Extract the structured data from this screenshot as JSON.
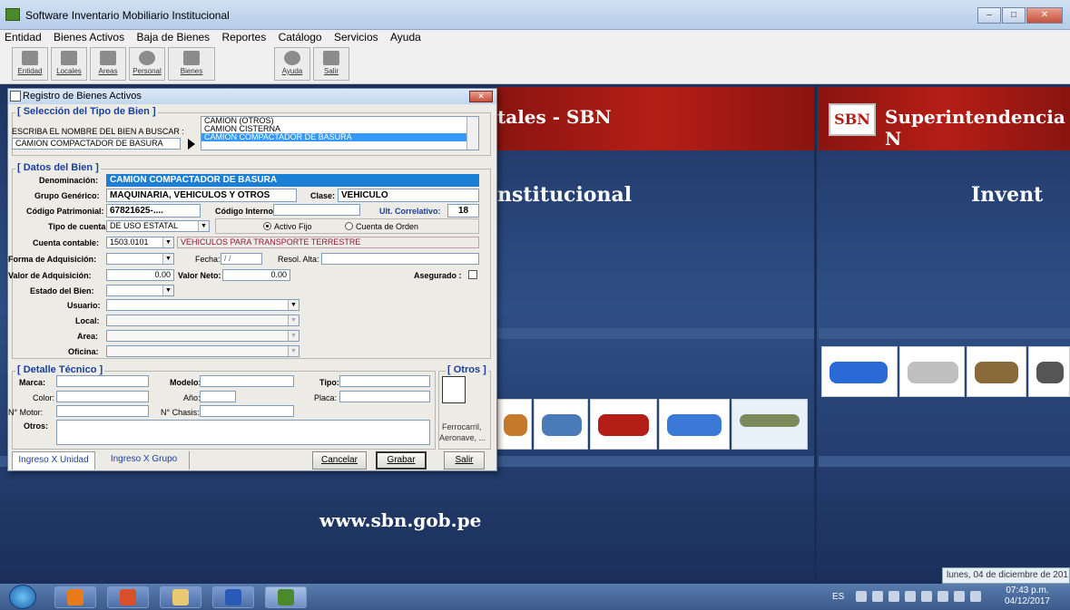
{
  "window": {
    "title": "Software Inventario Mobiliario Institucional",
    "controls": [
      "–",
      "□",
      "✕"
    ]
  },
  "menu": [
    "Entidad",
    "Bienes Activos",
    "Baja de Bienes",
    "Reportes",
    "Catálogo",
    "Servicios",
    "Ayuda"
  ],
  "toolbar": [
    "Entidad",
    "Locales",
    "Areas",
    "Personal",
    "Bienes",
    "Ayuda",
    "Salir"
  ],
  "background": {
    "band_left": "tales - SBN",
    "band_right": "Superintendencia N",
    "logo": "SBN",
    "big_left": "nstitucional",
    "big_right": "Invent",
    "url": "www.sbn.gob.pe",
    "date_chip": "lunes, 04 de diciembre de 201"
  },
  "dialog": {
    "title": "Registro de Bienes Activos",
    "close": "✕",
    "seleccion": {
      "title": "[ Selección del Tipo de Bien ]",
      "prompt": "ESCRIBA EL NOMBRE DEL BIEN A BUSCAR :",
      "search_value": "CAMION COMPACTADOR DE BASURA",
      "options": [
        "CAMION (OTROS)",
        "CAMION CISTERNA",
        "CAMION COMPACTADOR DE BASURA"
      ],
      "selected_index": 2
    },
    "datos": {
      "title": "[ Datos del Bien ]",
      "denominacion_label": "Denominación:",
      "denominacion_value": "CAMION COMPACTADOR DE BASURA",
      "grupo_label": "Grupo Genérico:",
      "grupo_value": "MAQUINARIA, VEHICULOS Y OTROS",
      "clase_label": "Clase:",
      "clase_value": "VEHICULO",
      "codigo_patrimonial_label": "Código Patrimonial:",
      "codigo_patrimonial_value": "67821625-....",
      "codigo_interno_label": "Código Interno:",
      "codigo_interno_value": "",
      "correlativo_label": "Ult. Correlativo:",
      "correlativo_value": "18",
      "tipo_cuenta_label": "Tipo de cuenta:",
      "tipo_cuenta_value": "DE USO ESTATAL",
      "activo_fijo_label": "Activo Fijo",
      "cuenta_orden_label": "Cuenta de Orden",
      "cuenta_contable_label": "Cuenta contable:",
      "cuenta_contable_value": "1503.0101",
      "cuenta_contable_desc": "VEHICULOS PARA TRANSPORTE TERRESTRE",
      "forma_label": "Forma de Adquisición:",
      "fecha_label": "Fecha:",
      "fecha_value": " / /",
      "resol_label": "Resol. Alta:",
      "valor_label": "Valor de Adquisición:",
      "valor_value": "0.00",
      "valor_neto_label": "Valor Neto:",
      "valor_neto_value": "0.00",
      "asegurado_label": "Asegurado :",
      "estado_label": "Estado del Bien:",
      "usuario_label": "Usuario:",
      "local_label": "Local:",
      "area_label": "Area:",
      "oficina_label": "Oficina:"
    },
    "detalle": {
      "title": "[ Detalle Técnico ]",
      "marca_label": "Marca:",
      "modelo_label": "Modelo:",
      "tipo_label": "Tipo:",
      "color_label": "Color:",
      "anio_label": "Año:",
      "placa_label": "Placa:",
      "motor_label": "N° Motor:",
      "chasis_label": "N° Chasis:",
      "otros_label": "Otros:"
    },
    "otros": {
      "title": "[ Otros ]",
      "line1": "Ferrocarril,",
      "line2": "Aeronave, ..."
    },
    "tabs": [
      "Ingreso X Unidad",
      "Ingreso X Grupo"
    ],
    "buttons": {
      "cancelar": "Cancelar",
      "grabar": "Grabar",
      "salir": "Salir"
    }
  },
  "taskbar": {
    "lang": "ES",
    "time": "07:43 p.m.",
    "date": "04/12/2017"
  },
  "colors": {
    "accent": "#1c7fd6",
    "band": "#b51e16",
    "group_title": "#1b3f9a"
  }
}
